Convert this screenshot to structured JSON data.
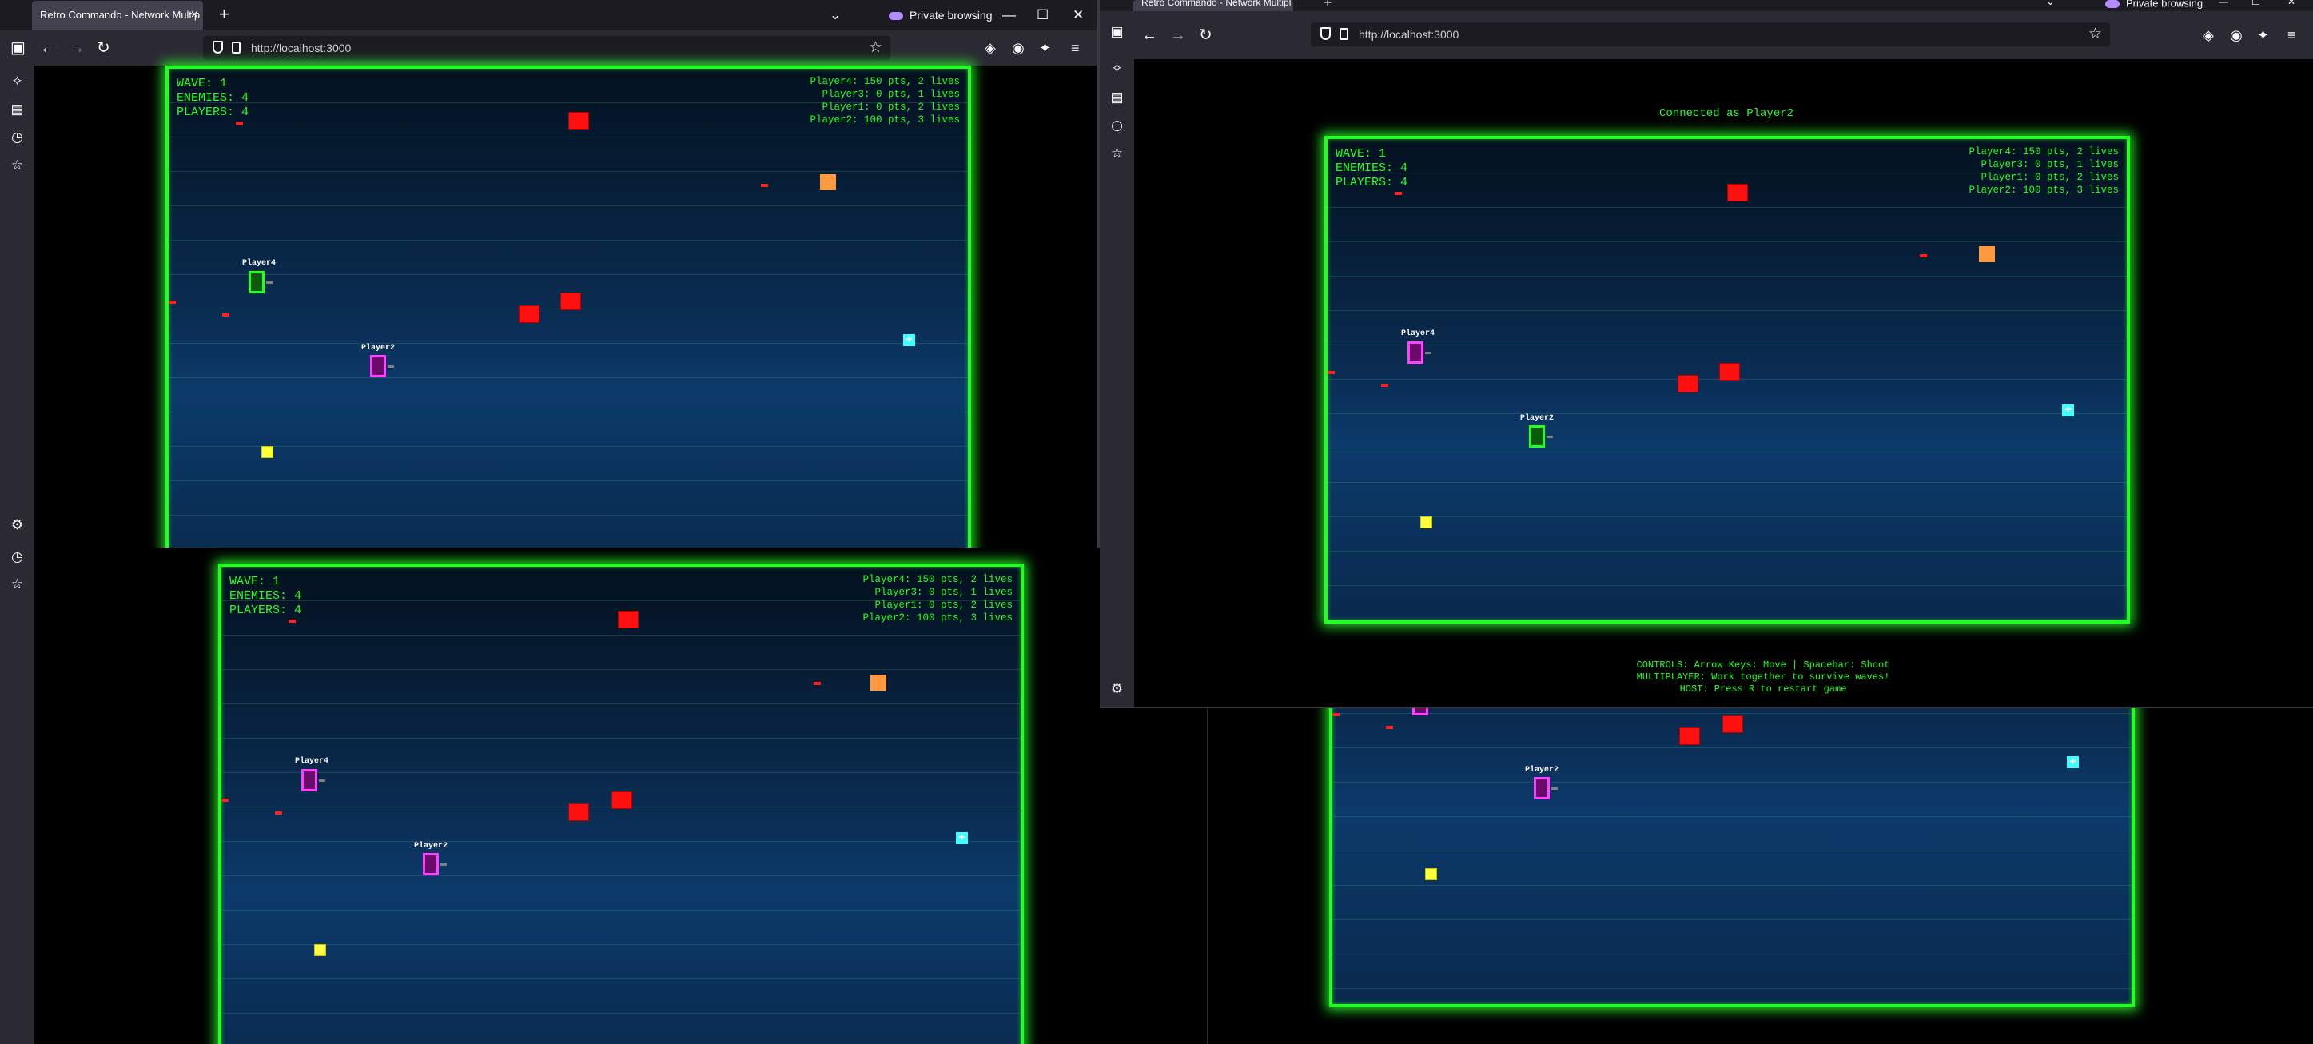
{
  "browser": {
    "tab_title": "Retro Commando - Network Multip",
    "tab_title_right": "Retro Commando - Network Multipl",
    "new_tab": "+",
    "private_label": "Private browsing",
    "url": "http://localhost:3000",
    "close_tab": "×",
    "win_minimize": "—",
    "win_maximize": "☐",
    "win_close": "✕",
    "icons": [
      "back-icon",
      "forward-icon",
      "reload-icon",
      "shield-icon",
      "page-icon",
      "star-icon",
      "pocket-icon",
      "account-icon",
      "extensions-icon",
      "menu-icon"
    ]
  },
  "sidebar": {
    "icons": [
      "sidebar-toggle-icon",
      "ai-chat-icon",
      "synced-tabs-icon",
      "history-icon",
      "bookmarks-icon",
      "settings-icon"
    ]
  },
  "game": {
    "hud": {
      "wave": "WAVE: 1",
      "enemies": "ENEMIES: 4",
      "players": "PLAYERS: 4"
    },
    "scores": [
      "Player4: 150 pts, 2 lives",
      "Player3: 0 pts, 1 lives",
      "Player1: 0 pts, 2 lives",
      "Player2: 100 pts, 3 lives"
    ],
    "labels": {
      "player4": "Player4",
      "player2": "Player2"
    },
    "powerup_symbol": "+",
    "connected": "Connected as Player2",
    "controls": [
      "CONTROLS: Arrow Keys: Move | Spacebar: Shoot",
      "MULTIPLAYER: Work together to survive waves!",
      "HOST: Press R to restart game"
    ]
  },
  "colors": {
    "hud_green": "#22ff22",
    "enemy_red": "#ff1010",
    "enemy_orange": "#ff9a40",
    "player_green": "#22ff22",
    "player_magenta": "#ff40ff",
    "powerup_cyan": "#40ffff",
    "powerup_yellow": "#ffff40"
  }
}
